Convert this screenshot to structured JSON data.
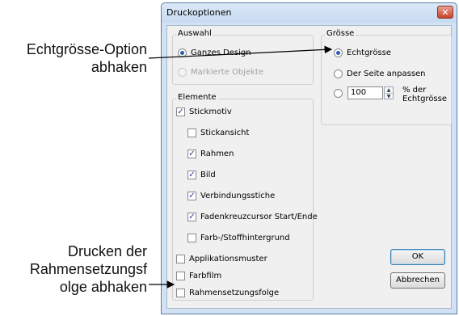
{
  "callouts": {
    "top": {
      "line1": "Echtgrösse-Option",
      "line2": "abhaken"
    },
    "bottom": {
      "line1": "Drucken der",
      "line2": "Rahmensetzungsf",
      "line3": "olge abhaken"
    }
  },
  "dialog": {
    "title": "Druckoptionen",
    "close_glyph": "✕",
    "auswahl": {
      "label": "Auswahl",
      "options": [
        {
          "label": "Ganzes Design",
          "checked": true,
          "disabled": false
        },
        {
          "label": "Markierte Objekte",
          "checked": false,
          "disabled": true
        }
      ]
    },
    "groesse": {
      "label": "Grösse",
      "options": [
        {
          "label": "Echtgrösse",
          "checked": true
        },
        {
          "label": "Der Seite anpassen",
          "checked": false
        },
        {
          "label": "",
          "checked": false
        }
      ],
      "percent_value": "100",
      "percent_label_line1": "% der",
      "percent_label_line2": "Echtgrösse"
    },
    "elemente": {
      "label": "Elemente",
      "items": [
        {
          "label": "Stickmotiv",
          "checked": true
        },
        {
          "label": "Stickansicht",
          "checked": false
        },
        {
          "label": "Rahmen",
          "checked": true
        },
        {
          "label": "Bild",
          "checked": true
        },
        {
          "label": "Verbindungsstiche",
          "checked": true
        },
        {
          "label": "Fadenkreuzcursor Start/Ende",
          "checked": true
        },
        {
          "label": "Farb-/Stoffhintergrund",
          "checked": false
        },
        {
          "label": "Applikationsmuster",
          "checked": false
        },
        {
          "label": "Farbfilm",
          "checked": false
        },
        {
          "label": "Rahmensetzungsfolge",
          "checked": false
        }
      ]
    },
    "buttons": {
      "ok": "OK",
      "cancel": "Abbrechen"
    }
  },
  "colors": {
    "accent": "#2a5db0",
    "frame": "#d2e2f4"
  }
}
